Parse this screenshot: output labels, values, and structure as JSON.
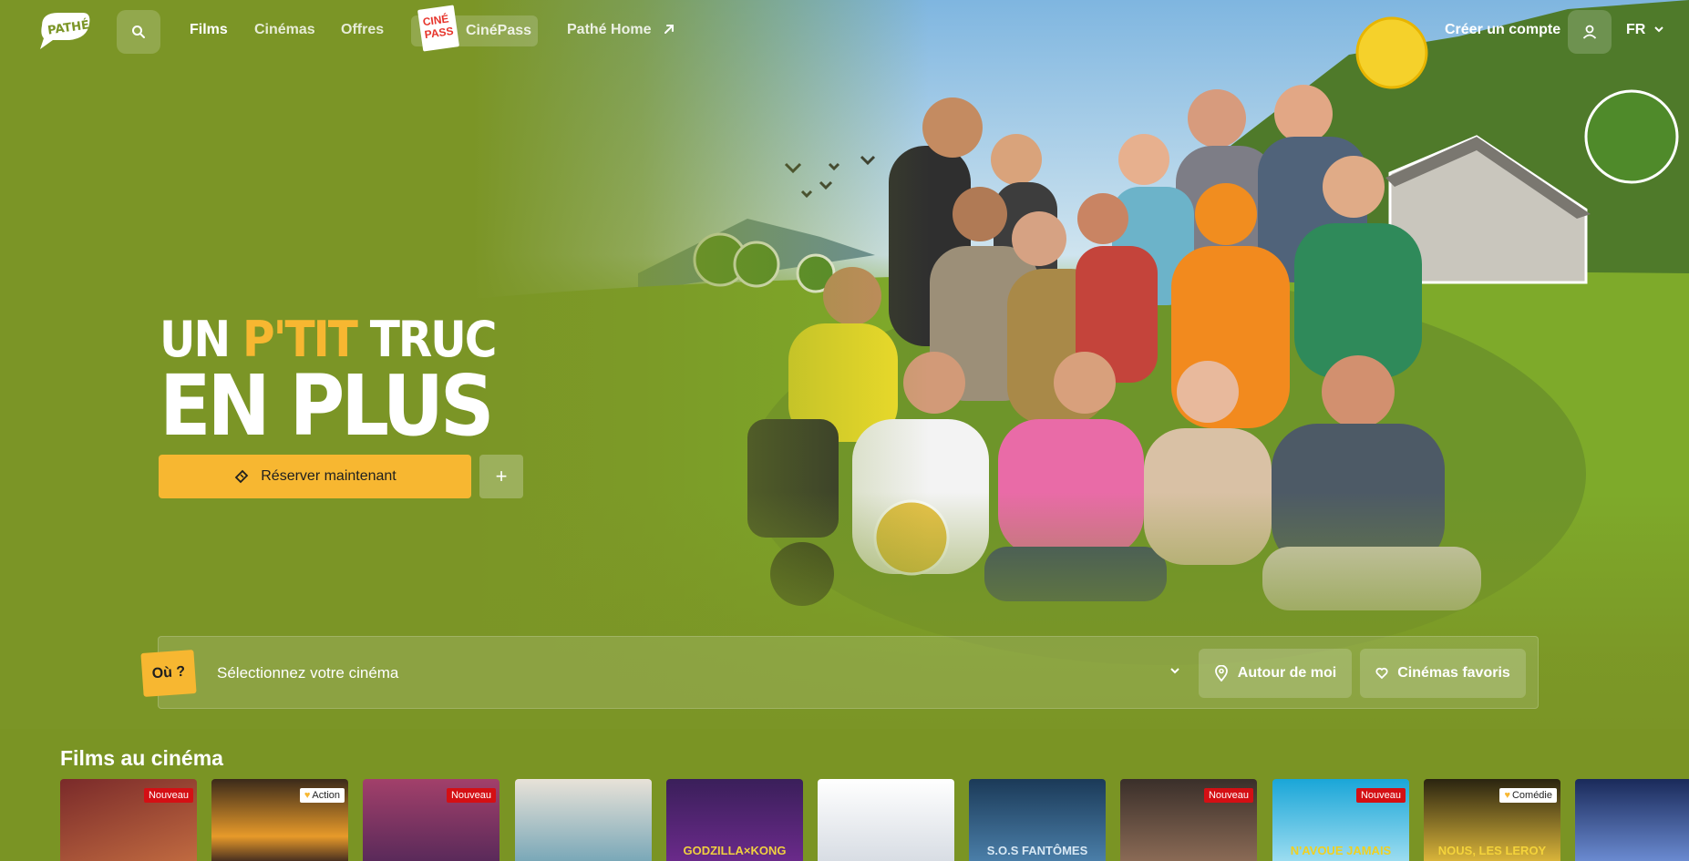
{
  "nav": {
    "logo_alt": "Pathé",
    "links": [
      "Films",
      "Cinémas",
      "Offres"
    ],
    "cinepass_label": "CinéPass",
    "cinepass_logo_top": "CINÉ",
    "cinepass_logo_bottom": "PASS",
    "home_label": "Pathé Home",
    "create_account": "Créer un compte",
    "language": "FR"
  },
  "hero": {
    "title_word1": "UN",
    "title_word2": "P'TIT",
    "title_word3": "TRUC",
    "title_line2": "EN PLUS",
    "book_label": "Réserver maintenant",
    "plus_symbol": "+"
  },
  "selector": {
    "badge": "Où ?",
    "placeholder": "Sélectionnez votre cinéma",
    "nearby": "Autour de moi",
    "favorites": "Cinémas favoris"
  },
  "films": {
    "heading": "Films au cinéma",
    "posters": [
      {
        "badge": "Nouveau",
        "type": "new",
        "title": ""
      },
      {
        "badge": "Action",
        "type": "genre",
        "heart": true,
        "title": ""
      },
      {
        "badge": "Nouveau",
        "type": "new",
        "title": ""
      },
      {
        "badge": "",
        "type": "",
        "title": ""
      },
      {
        "badge": "",
        "type": "",
        "title": "GODZILLA×KONG"
      },
      {
        "badge": "",
        "type": "",
        "title": ""
      },
      {
        "badge": "",
        "type": "",
        "title": "S.O.S FANTÔMES"
      },
      {
        "badge": "Nouveau",
        "type": "new",
        "title": ""
      },
      {
        "badge": "Nouveau",
        "type": "new",
        "title": "N'AVOUE JAMAIS"
      },
      {
        "badge": "Comédie",
        "type": "genre",
        "heart": true,
        "title": "NOUS, LES LEROY"
      },
      {
        "badge": "",
        "type": "",
        "title": ""
      }
    ]
  },
  "colors": {
    "brand_yellow": "#f7b731",
    "hero_green": "#7b9526",
    "new_red": "#d40f14"
  }
}
